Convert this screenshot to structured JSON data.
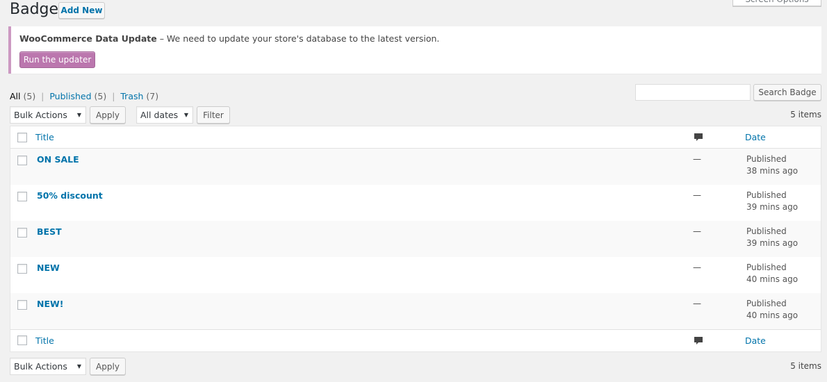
{
  "header": {
    "title": "Badge",
    "add_new": "Add New",
    "screen_options": "Screen Options"
  },
  "notice": {
    "bold": "WooCommerce Data Update",
    "text": " – We need to update your store's database to the latest version.",
    "button": "Run the updater",
    "accent": "#bb77ae"
  },
  "views": [
    {
      "label": "All",
      "count": "(5)",
      "current": true
    },
    {
      "label": "Published",
      "count": "(5)"
    },
    {
      "label": "Trash",
      "count": "(7)"
    }
  ],
  "search": {
    "value": "",
    "button": "Search Badge"
  },
  "tablenav": {
    "bulk": "Bulk Actions",
    "apply": "Apply",
    "dates": "All dates",
    "filter": "Filter",
    "count": "5 items"
  },
  "columns": {
    "title": "Title",
    "comments_icon": "comment-bubble-icon",
    "date": "Date"
  },
  "rows": [
    {
      "title": "ON SALE",
      "comments": "—",
      "status": "Published",
      "time": "38 mins ago"
    },
    {
      "title": "50% discount",
      "comments": "—",
      "status": "Published",
      "time": "39 mins ago"
    },
    {
      "title": "BEST",
      "comments": "—",
      "status": "Published",
      "time": "39 mins ago"
    },
    {
      "title": "NEW",
      "comments": "—",
      "status": "Published",
      "time": "40 mins ago"
    },
    {
      "title": "NEW!",
      "comments": "—",
      "status": "Published",
      "time": "40 mins ago"
    }
  ]
}
